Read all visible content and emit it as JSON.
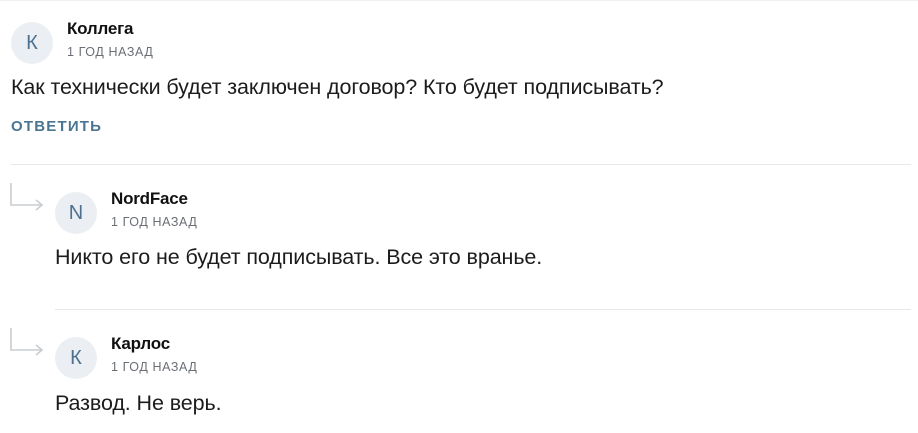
{
  "comments": [
    {
      "avatar_letter": "К",
      "author": "Коллега",
      "time": "1 ГОД НАЗАД",
      "text": "Как технически будет заключен договор? Кто будет подписывать?",
      "reply_label": "ОТВЕТИТЬ"
    }
  ],
  "replies": [
    {
      "avatar_letter": "N",
      "author": "NordFace",
      "time": "1 ГОД НАЗАД",
      "text": "Никто его не будет подписывать. Все это вранье."
    },
    {
      "avatar_letter": "К",
      "author": "Карлос",
      "time": "1 ГОД НАЗАД",
      "text": "Развод. Не верь."
    }
  ],
  "icons": {
    "reply_arrow": "reply-arrow-icon"
  },
  "colors": {
    "avatar_bg": "#ebeff3",
    "avatar_letter": "#4d7291",
    "reply_button": "#4a7593",
    "meta_text": "#6a6f75",
    "divider": "#e8e8e8"
  }
}
